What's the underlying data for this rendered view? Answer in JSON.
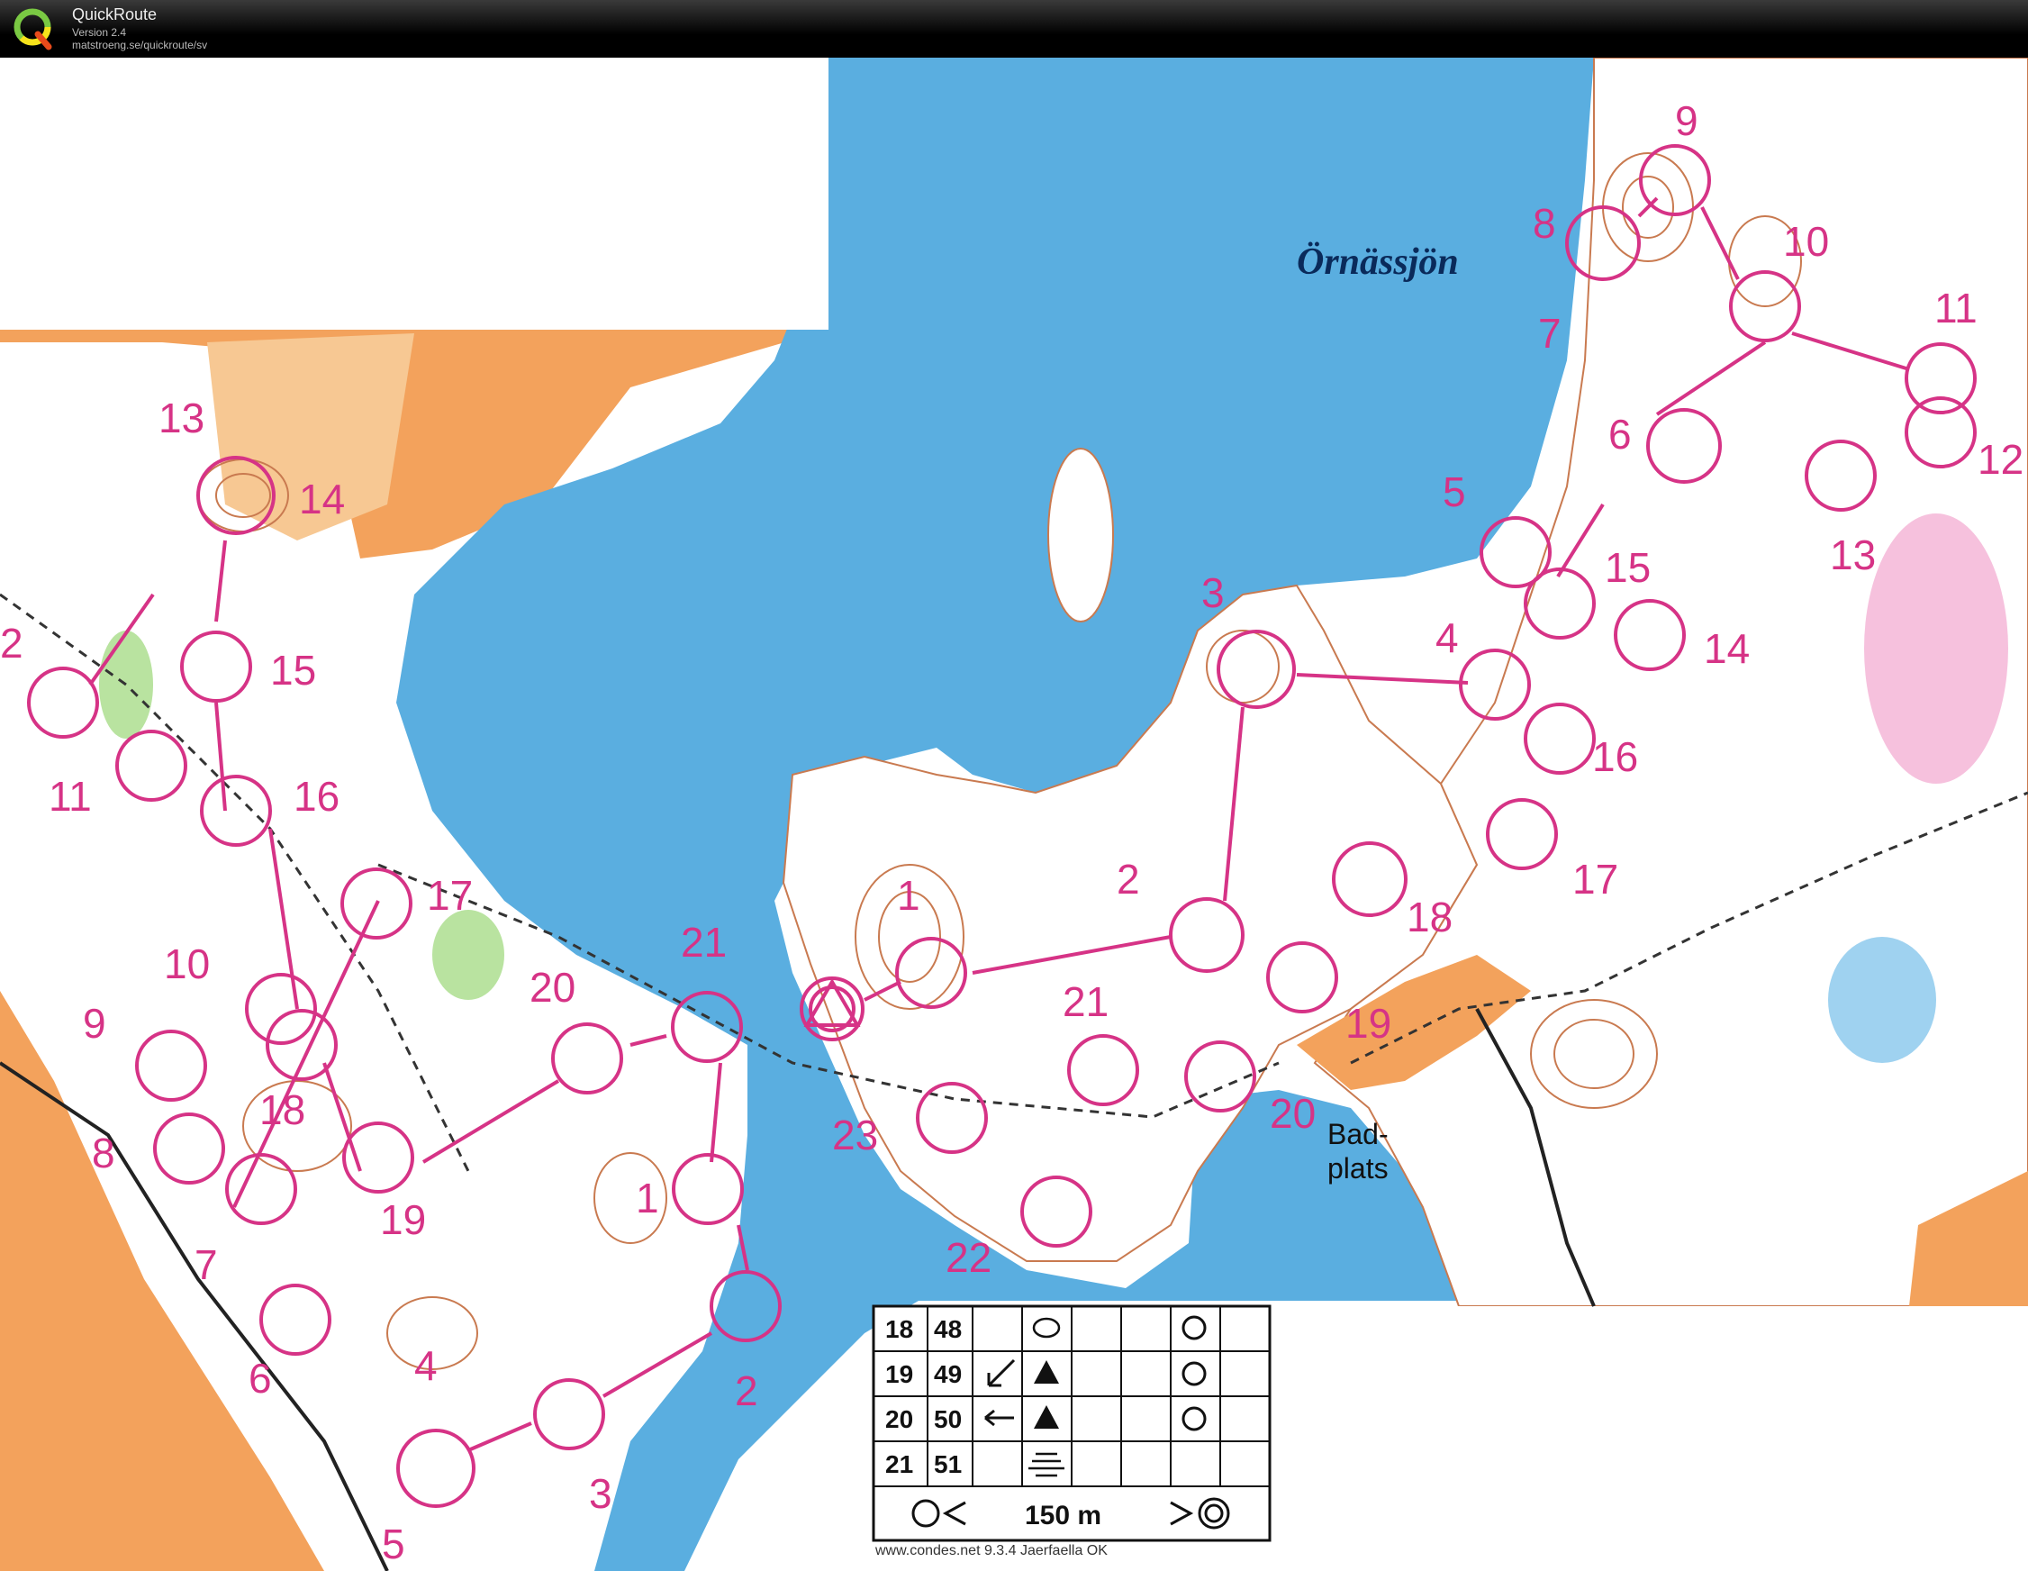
{
  "app": {
    "name": "QuickRoute",
    "version": "Version 2.4",
    "url": "matstroeng.se/quickroute/sv"
  },
  "map": {
    "lake_name": "Örnässjön",
    "place_label_1": "Bad-",
    "place_label_2": "plats",
    "course_a_numbers": [
      "2",
      "11",
      "13",
      "14",
      "15",
      "16",
      "17",
      "10",
      "9",
      "18",
      "8",
      "19",
      "7",
      "6",
      "4",
      "5",
      "20",
      "21",
      "1",
      "3",
      "2"
    ],
    "course_b_numbers": [
      "9",
      "8",
      "7",
      "10",
      "11",
      "12",
      "6",
      "5",
      "13",
      "15",
      "14",
      "3",
      "4",
      "16",
      "17",
      "18",
      "2",
      "1",
      "19",
      "21",
      "20",
      "23",
      "22"
    ],
    "legend": {
      "rows": [
        {
          "num": "18",
          "code": "48"
        },
        {
          "num": "19",
          "code": "49"
        },
        {
          "num": "20",
          "code": "50"
        },
        {
          "num": "21",
          "code": "51"
        }
      ],
      "distance": "150 m",
      "footer": "www.condes.net 9.3.4 Jaerfaella OK"
    }
  },
  "colors": {
    "water": "#5aaee0",
    "water_shallow": "#9fd2f0",
    "open": "#f3a25c",
    "rough": "#f7c893",
    "forest": "#ffffff",
    "green": "#b9e3a0",
    "contour": "#c97a50",
    "course": "#d63386",
    "titlebar": "#111111"
  },
  "icons": [
    "quickroute-logo-icon"
  ]
}
